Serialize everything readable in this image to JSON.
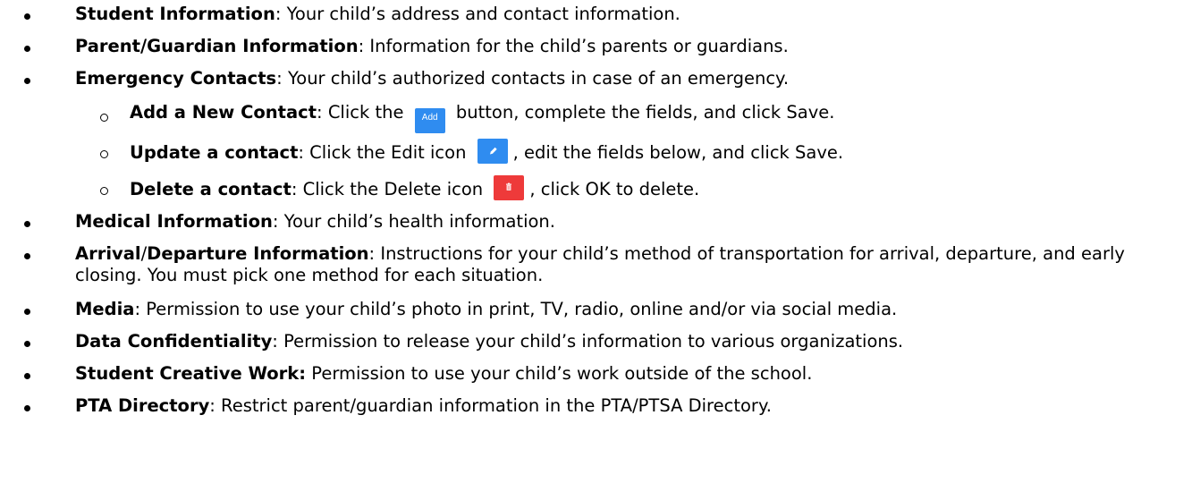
{
  "items": [
    {
      "label": "Student Information",
      "desc": ": Your child’s address and contact information."
    },
    {
      "label": "Parent/Guardian Information",
      "desc": ": Information for the child’s parents or guardians."
    },
    {
      "label": "Emergency Contacts",
      "desc": ": Your child’s authorized contacts in case of an emergency."
    },
    {
      "label": "Add a New Contact",
      "desc_before": ": Click the ",
      "button_label": "Add",
      "desc_after": " button, complete the fields, and click Save."
    },
    {
      "label": "Update a contact",
      "desc_before": ": Click the Edit icon ",
      "icon": "pencil-icon",
      "desc_after": ", edit the fields below, and click Save."
    },
    {
      "label": "Delete a contact",
      "desc_before": ": Click the Delete icon ",
      "icon": "trash-icon",
      "desc_after": ", click OK to delete."
    },
    {
      "label": "Medical Information",
      "desc": ": Your child’s health information."
    },
    {
      "label_part1": "Arrival",
      "label_sep": "/",
      "label_part2": "Departure Information",
      "desc": ": Instructions for your child’s method of transportation for arrival, departure, and early closing. You must pick one method for each situation."
    },
    {
      "label": "Media",
      "desc": ": Permission to use your child’s photo in print, TV, radio, online and/or via social media."
    },
    {
      "label": "Data Confidentiality",
      "desc": ": Permission to release your child’s information to various organizations."
    },
    {
      "label": "Student Creative Work:",
      "desc": " Permission to use your child’s work outside of the school."
    },
    {
      "label": "PTA Directory",
      "desc": ": Restrict parent/guardian information in the PTA/PTSA Directory."
    }
  ],
  "colors": {
    "button_blue": "#2f8cf0",
    "button_red": "#ee3a3a"
  }
}
